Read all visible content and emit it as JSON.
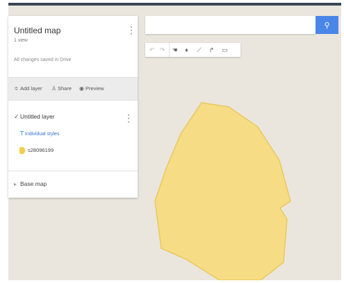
{
  "panel": {
    "title": "Untitled map",
    "subtitle": "1 view",
    "save_status": "All changes saved in Drive",
    "actions": {
      "add_layer": "Add layer",
      "share": "Share",
      "preview": "Preview"
    },
    "layer": {
      "name": "Untitled layer",
      "style_link": "Individual styles",
      "feature": "s28096199"
    },
    "base_map": "Base map"
  },
  "search": {
    "value": "",
    "placeholder": ""
  },
  "toolbar": {
    "tools": [
      "undo-icon",
      "redo-icon",
      "pan-hand-icon",
      "add-marker-icon",
      "draw-line-icon",
      "add-directions-icon",
      "measure-icon"
    ]
  },
  "colors": {
    "map_background": "#eae6de",
    "polygon_fill": "#f6dc85",
    "polygon_stroke": "#e9c95d",
    "accent": "#4a86e8",
    "topbar": "#3a4754"
  }
}
